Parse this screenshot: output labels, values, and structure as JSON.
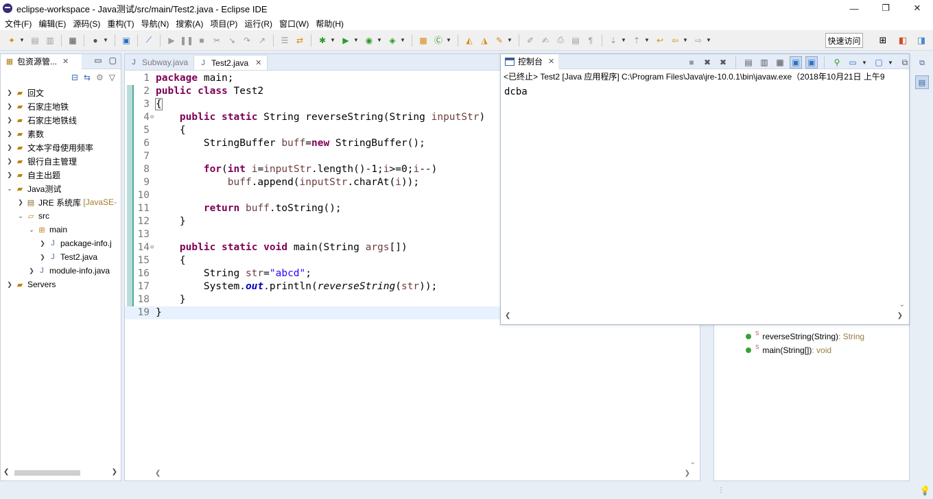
{
  "window": {
    "title": "eclipse-workspace - Java测试/src/main/Test2.java - Eclipse IDE",
    "minimize": "—",
    "maximize": "❐",
    "close": "✕"
  },
  "menu": [
    "文件(F)",
    "编辑(E)",
    "源码(S)",
    "重构(T)",
    "导航(N)",
    "搜索(A)",
    "项目(P)",
    "运行(R)",
    "窗口(W)",
    "帮助(H)"
  ],
  "toolbar": {
    "quick_access": "快速访问"
  },
  "package_explorer": {
    "tab_label": "包资源管...",
    "tree": [
      {
        "label": "回文",
        "suffix": ""
      },
      {
        "label": "石家庄地铁",
        "suffix": ""
      },
      {
        "label": "石家庄地铁线",
        "suffix": ""
      },
      {
        "label": "素数",
        "suffix": ""
      },
      {
        "label": "文本字母使用频率",
        "suffix": ""
      },
      {
        "label": "银行自主管理",
        "suffix": ""
      },
      {
        "label": "自主出题",
        "suffix": ""
      },
      {
        "label": "Java测试",
        "suffix": ""
      },
      {
        "label": "JRE 系统库",
        "suffix": "[JavaSE-"
      },
      {
        "label": "src",
        "suffix": ""
      },
      {
        "label": "main",
        "suffix": ""
      },
      {
        "label": "package-info.j",
        "suffix": ""
      },
      {
        "label": "Test2.java",
        "suffix": ""
      },
      {
        "label": "module-info.java",
        "suffix": ""
      },
      {
        "label": "Servers",
        "suffix": ""
      }
    ]
  },
  "editor": {
    "tabs": [
      "Subway.java",
      "Test2.java"
    ],
    "line_numbers": [
      "1",
      "2",
      "3",
      "4",
      "5",
      "6",
      "7",
      "8",
      "9",
      "10",
      "11",
      "12",
      "13",
      "14",
      "15",
      "16",
      "17",
      "18",
      "19"
    ]
  },
  "console": {
    "tab_label": "控制台",
    "status": "<已终止> Test2 [Java 应用程序] C:\\Program Files\\Java\\jre-10.0.1\\bin\\javaw.exe（2018年10月21日 上午9",
    "output": "dcba"
  },
  "outline": {
    "items": [
      {
        "name": "reverseString(String)",
        "type": " : String"
      },
      {
        "name": "main(String[])",
        "type": " : void"
      }
    ]
  },
  "icons": {
    "accent": "#3b5f95",
    "keyword": "#7f0055",
    "string": "#2a00ff"
  }
}
